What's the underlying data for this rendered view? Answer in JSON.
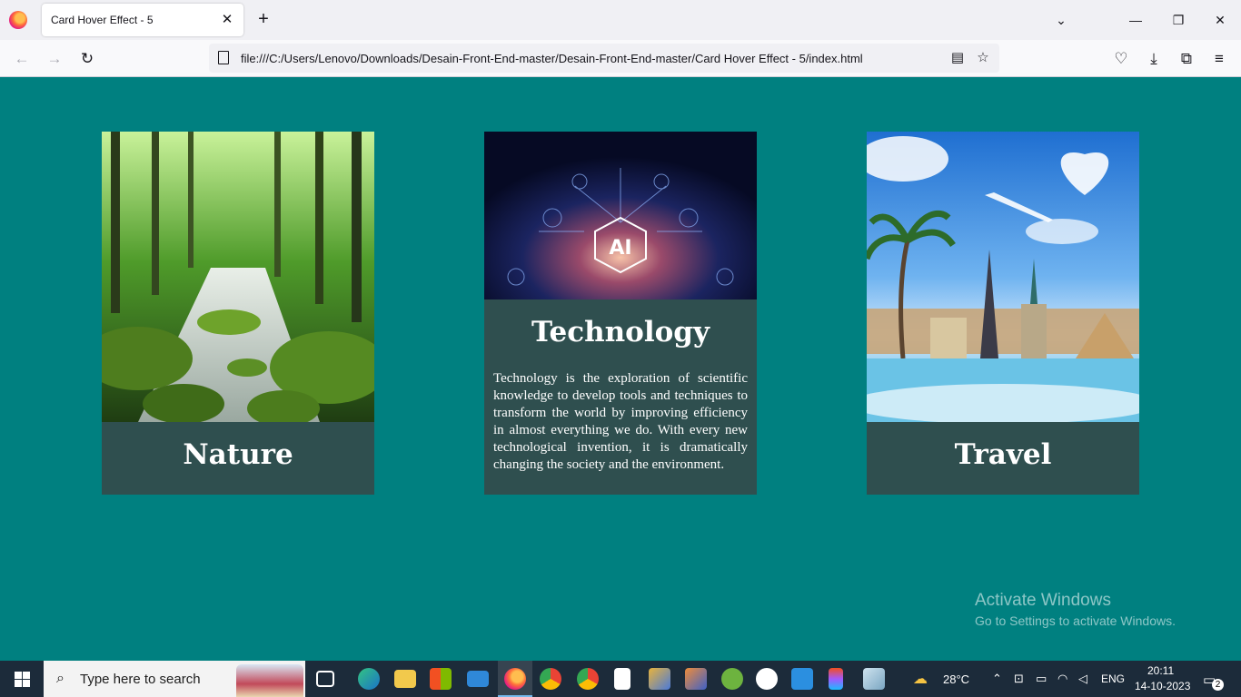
{
  "browser": {
    "tab_title": "Card Hover Effect - 5",
    "url": "file:///C:/Users/Lenovo/Downloads/Desain-Front-End-master/Desain-Front-End-master/Card Hover Effect - 5/index.html"
  },
  "cards": [
    {
      "title": "Nature",
      "image": "forest-stream-photo"
    },
    {
      "title": "Technology",
      "image": "ai-circuit-photo",
      "description": "Technology is the exploration of scientific knowledge to develop tools and techniques to transform the world by improving efficiency in almost everything we do. With every new technological invention, it is dramatically changing the society and the environment."
    },
    {
      "title": "Travel",
      "image": "world-landmarks-photo"
    }
  ],
  "watermark": {
    "line1": "Activate Windows",
    "line2": "Go to Settings to activate Windows."
  },
  "taskbar": {
    "search_placeholder": "Type here to search",
    "weather": "28°C",
    "language": "ENG",
    "time": "20:11",
    "date": "14-10-2023",
    "notifications": "2"
  },
  "colors": {
    "page_bg": "#008080",
    "card_bg": "#2f4f4f",
    "taskbar_bg": "#1c2b3a"
  }
}
